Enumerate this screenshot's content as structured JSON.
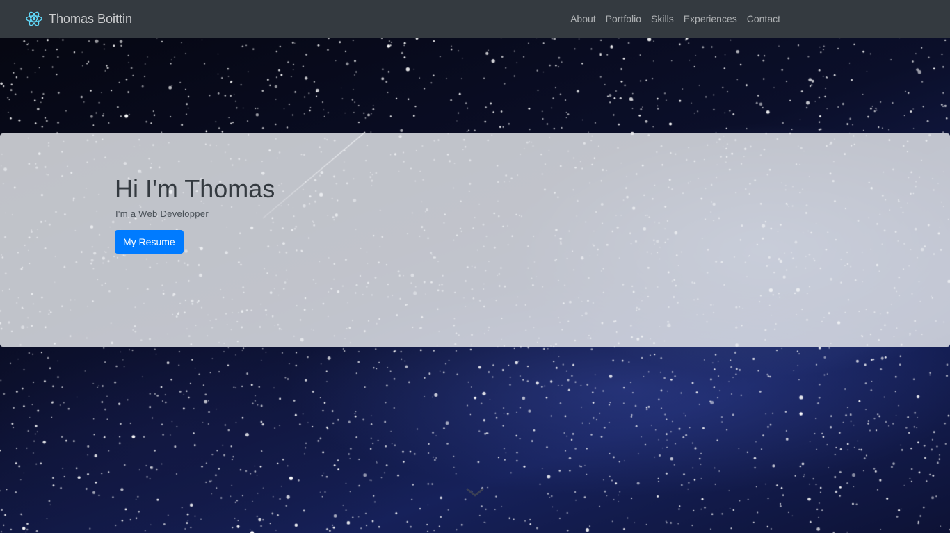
{
  "navbar": {
    "brand": "Thomas Boittin",
    "brand_icon": "react-atom-icon",
    "links": [
      "About",
      "Portfolio",
      "Skills",
      "Experiences",
      "Contact"
    ]
  },
  "hero": {
    "title": "Hi I'm Thomas",
    "subtitle": "I'm a Web Developper",
    "button_label": "My Resume"
  },
  "scroll_indicator": {
    "icon": "chevron-down-icon"
  },
  "colors": {
    "navbar_bg": "#343a40",
    "primary": "#007bff",
    "brand_icon": "#61dafb",
    "hero_panel": "#e9ecef"
  }
}
